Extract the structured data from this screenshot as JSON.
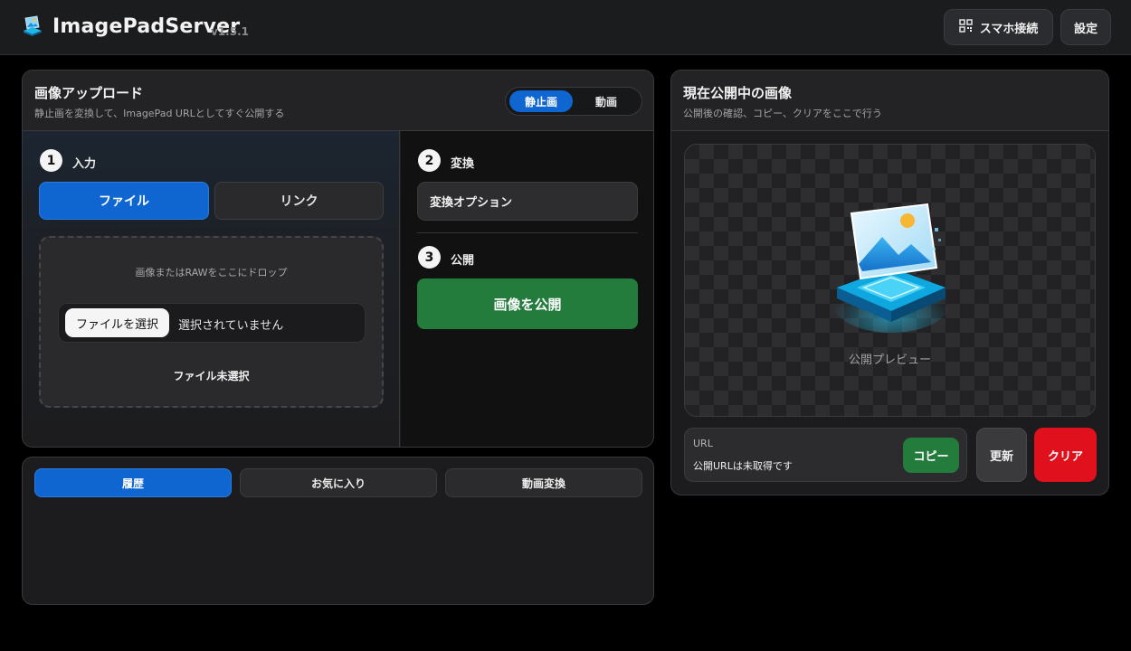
{
  "header": {
    "app_title": "ImagePadServer",
    "version": "v1.5.1",
    "mobile_connect_label": "スマホ接続",
    "settings_label": "設定",
    "logo_icon": "imagepad-logo-icon",
    "qr_icon": "qr-code-icon"
  },
  "upload": {
    "title": "画像アップロード",
    "subtitle": "静止画を変換して、ImagePad URLとしてすぐ公開する",
    "mode_tabs": [
      {
        "label": "静止画",
        "active": true
      },
      {
        "label": "動画",
        "active": false
      }
    ],
    "step1": {
      "number": "1",
      "label": "入力",
      "source_tabs": [
        {
          "label": "ファイル",
          "active": true
        },
        {
          "label": "リンク",
          "active": false
        }
      ],
      "drop_hint": "画像またはRAWをここにドロップ",
      "choose_file_label": "ファイルを選択",
      "no_file_text": "選択されていません",
      "file_status": "ファイル未選択"
    },
    "step2": {
      "number": "2",
      "label": "変換",
      "options_label": "変換オプション"
    },
    "step3": {
      "number": "3",
      "label": "公開",
      "publish_label": "画像を公開"
    }
  },
  "history": {
    "tabs": [
      {
        "label": "履歴",
        "active": true
      },
      {
        "label": "お気に入り",
        "active": false
      },
      {
        "label": "動画変換",
        "active": false
      }
    ]
  },
  "public": {
    "title": "現在公開中の画像",
    "subtitle": "公開後の確認、コピー、クリアをここで行う",
    "preview_label": "公開プレビュー",
    "url_label": "URL",
    "url_value": "公開URLは未取得です",
    "copy_label": "コピー",
    "refresh_label": "更新",
    "clear_label": "クリア"
  },
  "colors": {
    "accent_blue": "#0f66d0",
    "success_green": "#237c3c",
    "danger_red": "#e0101c",
    "background": "#000000"
  }
}
